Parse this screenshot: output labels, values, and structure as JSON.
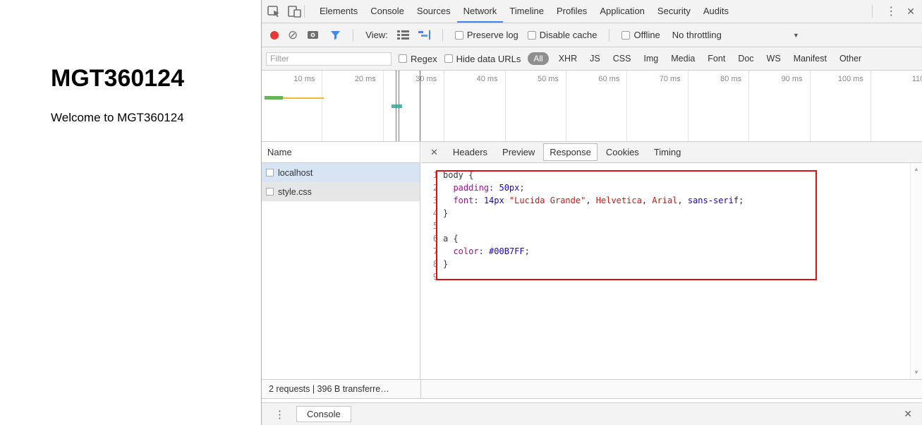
{
  "icons": {
    "close": "✕",
    "kebab": "⋮",
    "dropdown_arrow": "▼",
    "clear": "⊘",
    "scroll_up": "▲",
    "scroll_down": "▼"
  },
  "colors": {
    "accent_blue": "#4285f4",
    "record_red": "#e53935",
    "annotation_red": "#dd1111",
    "selection_blue": "#d7e4f3",
    "css_property": "#aa0d91",
    "css_value": "#1c00cf",
    "css_string": "#c41a16"
  },
  "page": {
    "heading": "MGT360124",
    "welcome": "Welcome to MGT360124"
  },
  "devtools": {
    "main_tabs": [
      "Elements",
      "Console",
      "Sources",
      "Network",
      "Timeline",
      "Profiles",
      "Application",
      "Security",
      "Audits"
    ],
    "active_main_tab": "Network",
    "network_toolbar": {
      "view_label": "View:",
      "preserve_log": "Preserve log",
      "disable_cache": "Disable cache",
      "offline": "Offline",
      "throttling": "No throttling"
    },
    "filter_bar": {
      "placeholder": "Filter",
      "regex": "Regex",
      "hide_data_urls": "Hide data URLs",
      "types": [
        "All",
        "XHR",
        "JS",
        "CSS",
        "Img",
        "Media",
        "Font",
        "Doc",
        "WS",
        "Manifest",
        "Other"
      ],
      "active_type": "All"
    },
    "overview_ticks": [
      "10 ms",
      "20 ms",
      "30 ms",
      "40 ms",
      "50 ms",
      "60 ms",
      "70 ms",
      "80 ms",
      "90 ms",
      "100 ms",
      "110"
    ],
    "requests": {
      "name_header": "Name",
      "rows": [
        "localhost",
        "style.css"
      ],
      "selected": "localhost"
    },
    "detail_tabs": [
      "Headers",
      "Preview",
      "Response",
      "Cookies",
      "Timing"
    ],
    "active_detail_tab": "Response",
    "response_lines": [
      {
        "n": "1",
        "tokens": [
          {
            "t": "body {",
            "c": "plain"
          }
        ]
      },
      {
        "n": "2",
        "tokens": [
          {
            "t": "  ",
            "c": "plain"
          },
          {
            "t": "padding",
            "c": "property"
          },
          {
            "t": ": ",
            "c": "plain"
          },
          {
            "t": "50px",
            "c": "value"
          },
          {
            "t": ";",
            "c": "plain"
          }
        ]
      },
      {
        "n": "3",
        "tokens": [
          {
            "t": "  ",
            "c": "plain"
          },
          {
            "t": "font",
            "c": "property"
          },
          {
            "t": ": ",
            "c": "plain"
          },
          {
            "t": "14px",
            "c": "value"
          },
          {
            "t": " ",
            "c": "plain"
          },
          {
            "t": "\"Lucida Grande\"",
            "c": "string"
          },
          {
            "t": ", ",
            "c": "plain"
          },
          {
            "t": "Helvetica",
            "c": "string"
          },
          {
            "t": ", ",
            "c": "plain"
          },
          {
            "t": "Arial",
            "c": "string"
          },
          {
            "t": ", ",
            "c": "plain"
          },
          {
            "t": "sans-serif",
            "c": "value"
          },
          {
            "t": ";",
            "c": "plain"
          }
        ]
      },
      {
        "n": "4",
        "tokens": [
          {
            "t": "}",
            "c": "plain"
          }
        ]
      },
      {
        "n": "5",
        "tokens": []
      },
      {
        "n": "6",
        "tokens": [
          {
            "t": "a {",
            "c": "plain"
          }
        ]
      },
      {
        "n": "7",
        "tokens": [
          {
            "t": "  ",
            "c": "plain"
          },
          {
            "t": "color",
            "c": "property"
          },
          {
            "t": ": ",
            "c": "plain"
          },
          {
            "t": "#00B7FF",
            "c": "value"
          },
          {
            "t": ";",
            "c": "plain"
          }
        ]
      },
      {
        "n": "8",
        "tokens": [
          {
            "t": "}",
            "c": "plain"
          }
        ]
      },
      {
        "n": "9",
        "tokens": []
      }
    ],
    "status_bar": {
      "summary": "2 requests  |  396 B transferre…"
    },
    "drawer": {
      "console": "Console"
    }
  }
}
